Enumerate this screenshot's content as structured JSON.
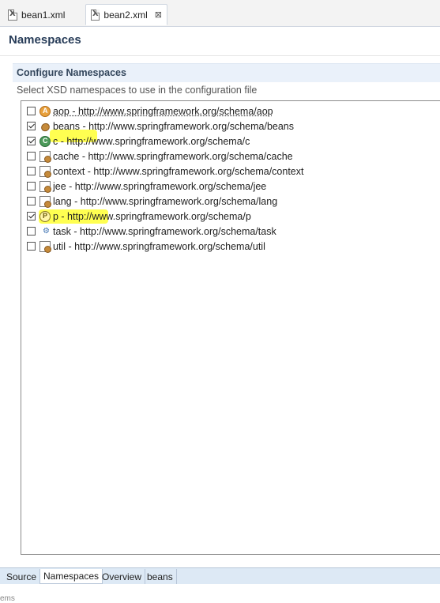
{
  "editor_tabs": [
    {
      "label": "bean1.xml",
      "active": false
    },
    {
      "label": "bean2.xml",
      "active": true
    }
  ],
  "tab_close_glyph": "⊠",
  "page": {
    "title": "Namespaces"
  },
  "section": {
    "title": "Configure Namespaces",
    "description": "Select XSD namespaces to use in the configuration file"
  },
  "namespaces": [
    {
      "label": "aop - http://www.springframework.org/schema/aop",
      "checked": false,
      "icon": "aop-icon"
    },
    {
      "label": "beans - http://www.springframework.org/schema/beans",
      "checked": true,
      "icon": "bean-icon"
    },
    {
      "label": "c - http://www.springframework.org/schema/c",
      "checked": true,
      "icon": "c-namespace-icon"
    },
    {
      "label": "cache - http://www.springframework.org/schema/cache",
      "checked": false,
      "icon": "doc-bean-icon"
    },
    {
      "label": "context - http://www.springframework.org/schema/context",
      "checked": false,
      "icon": "doc-icon"
    },
    {
      "label": "jee - http://www.springframework.org/schema/jee",
      "checked": false,
      "icon": "doc-icon"
    },
    {
      "label": "lang - http://www.springframework.org/schema/lang",
      "checked": false,
      "icon": "doc-bean-icon"
    },
    {
      "label": "p - http://www.springframework.org/schema/p",
      "checked": true,
      "icon": "p-namespace-icon"
    },
    {
      "label": "task - http://www.springframework.org/schema/task",
      "checked": false,
      "icon": "task-icon"
    },
    {
      "label": "util - http://www.springframework.org/schema/util",
      "checked": false,
      "icon": "doc-bean-icon"
    }
  ],
  "bottom_tabs": [
    {
      "label": "Source",
      "active": false
    },
    {
      "label": "Namespaces",
      "active": true
    },
    {
      "label": "Overview",
      "active": false
    },
    {
      "label": "beans",
      "active": false
    }
  ],
  "status_fragment": "ems",
  "colors": {
    "highlight": "#ffff33",
    "section_bg": "#eaf1fa",
    "bottom_tab_bg": "#dde9f5"
  }
}
